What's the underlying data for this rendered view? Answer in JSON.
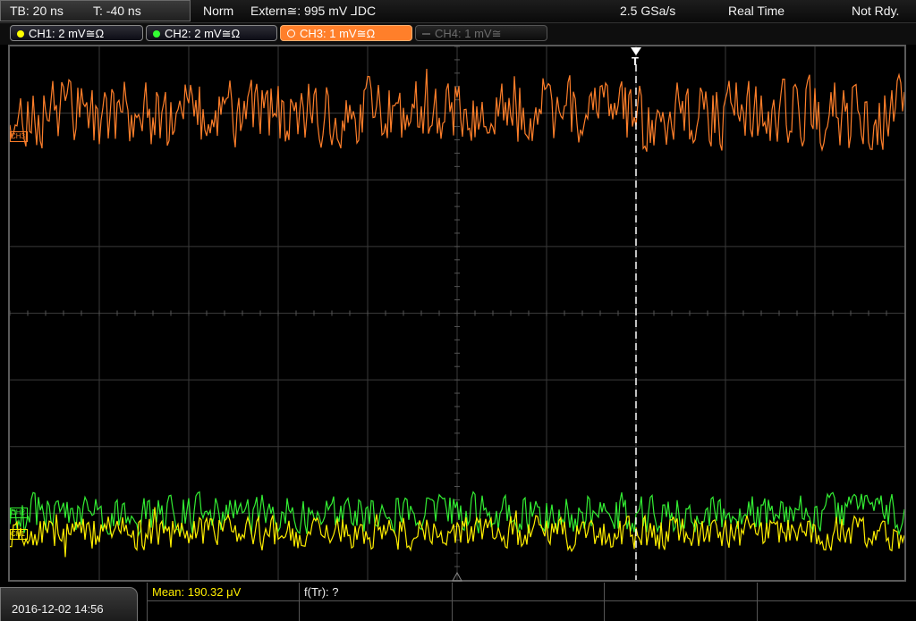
{
  "top": {
    "timebase": "TB: 20 ns",
    "trigger_time": "T: -40 ns",
    "trigger_mode": "Norm",
    "trigger_source": "Extern≅: 995 mV ⅃DC",
    "sample_rate": "2.5 GSa/s",
    "acq_mode": "Real Time",
    "status": "Not Rdy."
  },
  "channels": [
    {
      "label": "CH1: 2 mV≅Ω",
      "color": "#ffff00",
      "active": true
    },
    {
      "label": "CH2: 2 mV≅Ω",
      "color": "#33ff33",
      "active": true
    },
    {
      "label": "CH3: 1 mV≅Ω",
      "color": "#ff8a2a",
      "active": true,
      "selected": true
    },
    {
      "label": "CH4: 1 mV≅",
      "color": "#777777",
      "active": false
    }
  ],
  "markers": {
    "trigger_top": "T",
    "ch1": "CH1",
    "ch2": "CH2",
    "ch3": "CH3"
  },
  "waveforms": {
    "ch3": {
      "color": "#ff7f2a",
      "baseline_div": 1,
      "noise_div": 0.6
    },
    "ch2": {
      "color": "#33ee33",
      "baseline_div": 7,
      "noise_div": 0.35
    },
    "ch1": {
      "color": "#ffee00",
      "baseline_div": 7.3,
      "noise_div": 0.3
    }
  },
  "bottom": {
    "datetime": "2016-12-02 14:56",
    "mean_label": "Mean: 190.32 μV",
    "ftr_label": "f(Tr): ?"
  }
}
